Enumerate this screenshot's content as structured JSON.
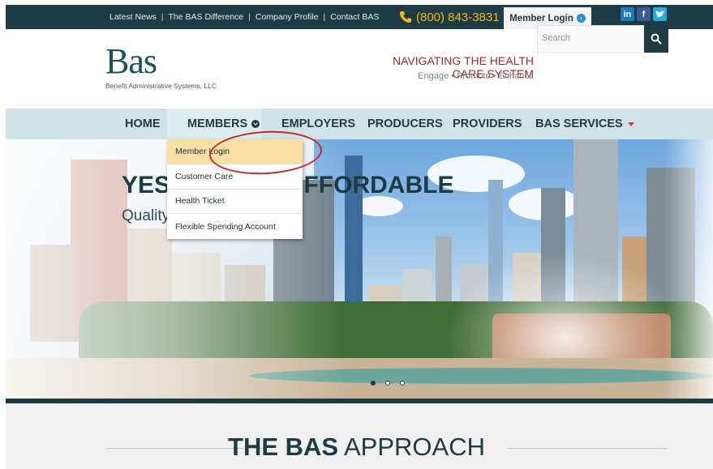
{
  "topbar": {
    "links": [
      "Latest News",
      "The BAS Difference",
      "Company Profile",
      "Contact BAS"
    ],
    "phone": "(800) 843-3831",
    "member_login": "Member Login",
    "social": [
      "in",
      "f",
      "t"
    ]
  },
  "header": {
    "logo": "Bas",
    "logo_sub": "Benefit Administrative Systems, LLC",
    "tagline": "NAVIGATING THE HEALTH CARE SYSTEM",
    "tagline_sub": "Engage • Promote • Enhance",
    "search_placeholder": "Search"
  },
  "nav": {
    "items": [
      "HOME",
      "MEMBERS",
      "EMPLOYERS",
      "PRODUCERS",
      "PROVIDERS",
      "BAS SERVICES"
    ]
  },
  "dropdown": {
    "items": [
      "Member Login",
      "Customer Care",
      "Health Ticket",
      "Flexible Spending Account"
    ]
  },
  "hero": {
    "title": "YES, WE ARE AFFORDABLE",
    "subtitle": "Quality health care for all"
  },
  "approach": {
    "bold": "THE BAS",
    "light": " APPROACH"
  },
  "colors": {
    "primary": "#1e3a42",
    "accent": "#f5b81c",
    "brand_red": "#9b2b25",
    "nav_bg": "#cfe3e8",
    "highlight": "#f8e0a4"
  }
}
